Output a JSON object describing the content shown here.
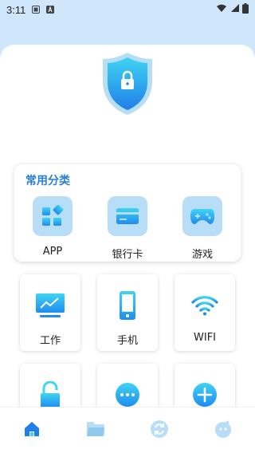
{
  "status_bar": {
    "time": "3:11"
  },
  "categories": {
    "title": "常用分类",
    "items": [
      {
        "label": "APP",
        "icon": "apps-icon"
      },
      {
        "label": "银行卡",
        "icon": "bank-card-icon"
      },
      {
        "label": "游戏",
        "icon": "gamepad-icon"
      }
    ]
  },
  "grid": {
    "items": [
      {
        "label": "工作",
        "icon": "monitor-chart-icon"
      },
      {
        "label": "手机",
        "icon": "phone-icon"
      },
      {
        "label": "WIFI",
        "icon": "wifi-icon"
      },
      {
        "label": "",
        "icon": "unlock-icon"
      },
      {
        "label": "",
        "icon": "more-icon"
      },
      {
        "label": "",
        "icon": "add-icon"
      }
    ]
  },
  "bottom_nav": {
    "items": [
      {
        "icon": "home-icon",
        "active": true
      },
      {
        "icon": "folder-icon",
        "active": false
      },
      {
        "icon": "sync-icon",
        "active": false
      },
      {
        "icon": "profile-icon",
        "active": false
      }
    ]
  },
  "colors": {
    "accent": "#2a7fd6",
    "icon_bg": "#b7ddf7",
    "icon_gradient_top": "#3fd4f2",
    "icon_gradient_bottom": "#1f8cf0",
    "page_bg": "#cfe6fb"
  }
}
